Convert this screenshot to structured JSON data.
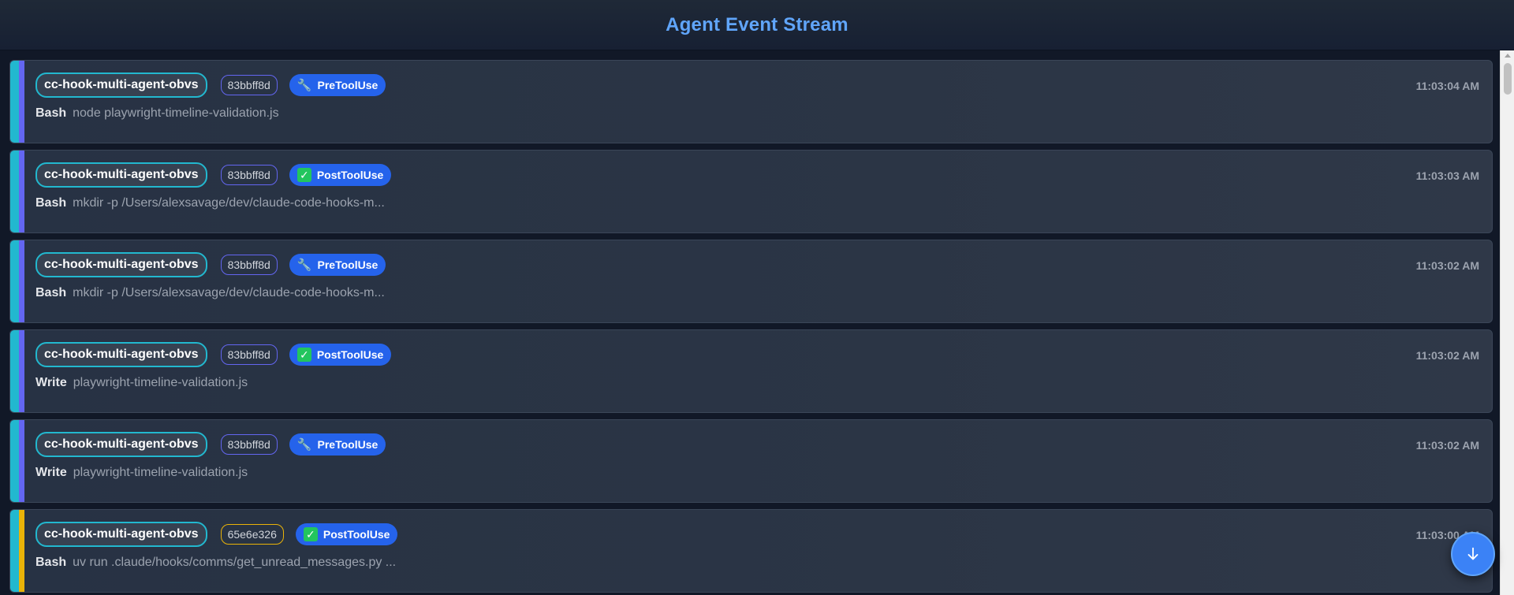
{
  "header": {
    "title": "Agent Event Stream"
  },
  "icons": {
    "pre": "wrench-icon",
    "post": "check-mark-icon",
    "scroll_bottom": "arrow-down-icon"
  },
  "colors": {
    "app_accent": "#22b8cf",
    "session_indigo": "#6366f1",
    "session_yellow": "#eab308",
    "type_badge": "#2563eb",
    "title": "#60a5fa"
  },
  "events": [
    {
      "app": "cc-hook-multi-agent-obvs",
      "session": "83bbff8d",
      "session_color": "#6366f1",
      "type": "PreToolUse",
      "icon": "🔧",
      "time": "11:03:04 AM",
      "tool": "Bash",
      "detail": "node playwright-timeline-validation.js"
    },
    {
      "app": "cc-hook-multi-agent-obvs",
      "session": "83bbff8d",
      "session_color": "#6366f1",
      "type": "PostToolUse",
      "icon": "✓",
      "time": "11:03:03 AM",
      "tool": "Bash",
      "detail": "mkdir -p /Users/alexsavage/dev/claude-code-hooks-m..."
    },
    {
      "app": "cc-hook-multi-agent-obvs",
      "session": "83bbff8d",
      "session_color": "#6366f1",
      "type": "PreToolUse",
      "icon": "🔧",
      "time": "11:03:02 AM",
      "tool": "Bash",
      "detail": "mkdir -p /Users/alexsavage/dev/claude-code-hooks-m..."
    },
    {
      "app": "cc-hook-multi-agent-obvs",
      "session": "83bbff8d",
      "session_color": "#6366f1",
      "type": "PostToolUse",
      "icon": "✓",
      "time": "11:03:02 AM",
      "tool": "Write",
      "detail": "playwright-timeline-validation.js"
    },
    {
      "app": "cc-hook-multi-agent-obvs",
      "session": "83bbff8d",
      "session_color": "#6366f1",
      "type": "PreToolUse",
      "icon": "🔧",
      "time": "11:03:02 AM",
      "tool": "Write",
      "detail": "playwright-timeline-validation.js"
    },
    {
      "app": "cc-hook-multi-agent-obvs",
      "session": "65e6e326",
      "session_color": "#eab308",
      "type": "PostToolUse",
      "icon": "✓",
      "time": "11:03:00 AM",
      "tool": "Bash",
      "detail": "uv run .claude/hooks/comms/get_unread_messages.py ..."
    }
  ]
}
